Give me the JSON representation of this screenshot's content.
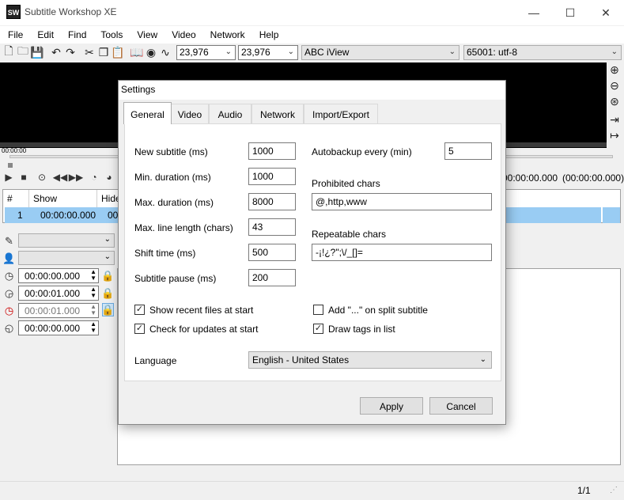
{
  "app": {
    "title": "Subtitle Workshop XE",
    "icon_text": "SW"
  },
  "window_controls": {
    "minimize": "—",
    "maximize": "☐",
    "close": "✕"
  },
  "menu": [
    "File",
    "Edit",
    "Find",
    "Tools",
    "View",
    "Video",
    "Network",
    "Help"
  ],
  "toolbar": {
    "fps_input": "23,976",
    "fps_output": "23,976",
    "service": "ABC iView",
    "encoding": "65001: utf-8"
  },
  "video": {
    "time_small": "00:00:00",
    "current_time": "00:00:00.000",
    "duration": "(00:00:00.000)"
  },
  "grid": {
    "headers": [
      "#",
      "Show",
      "Hide"
    ],
    "row": {
      "num": "1",
      "show": "00:00:00.000",
      "hide": "00"
    }
  },
  "edit_panel": {
    "show_time": "00:00:00.000",
    "hide_time": "00:00:01.000",
    "duration": "00:00:01.000",
    "pause": "00:00:00.000"
  },
  "status": {
    "pages": "1/1"
  },
  "dialog": {
    "title": "Settings",
    "tabs": [
      "General",
      "Video",
      "Audio",
      "Network",
      "Import/Export"
    ],
    "active_tab": "General",
    "fields": {
      "new_subtitle": {
        "label": "New subtitle (ms)",
        "value": "1000"
      },
      "min_duration": {
        "label": "Min. duration (ms)",
        "value": "1000"
      },
      "max_duration": {
        "label": "Max. duration (ms)",
        "value": "8000"
      },
      "max_line_length": {
        "label": "Max. line length (chars)",
        "value": "43"
      },
      "shift_time": {
        "label": "Shift time (ms)",
        "value": "500"
      },
      "subtitle_pause": {
        "label": "Subtitle pause (ms)",
        "value": "200"
      },
      "autobackup": {
        "label": "Autobackup every (min)",
        "value": "5"
      },
      "prohibited_chars": {
        "label": "Prohibited chars",
        "value": "@,http,www"
      },
      "repeatable_chars": {
        "label": "Repeatable chars",
        "value": "-¡!¿?\";\\/_[]="
      }
    },
    "checkboxes": {
      "show_recent": {
        "label": "Show recent files at start",
        "checked": true
      },
      "check_updates": {
        "label": "Check for updates at start",
        "checked": true
      },
      "add_ellipsis": {
        "label": "Add \"...\" on split subtitle",
        "checked": false
      },
      "draw_tags": {
        "label": "Draw tags in list",
        "checked": true
      }
    },
    "language": {
      "label": "Language",
      "value": "English - United States"
    },
    "buttons": {
      "apply": "Apply",
      "cancel": "Cancel"
    }
  }
}
